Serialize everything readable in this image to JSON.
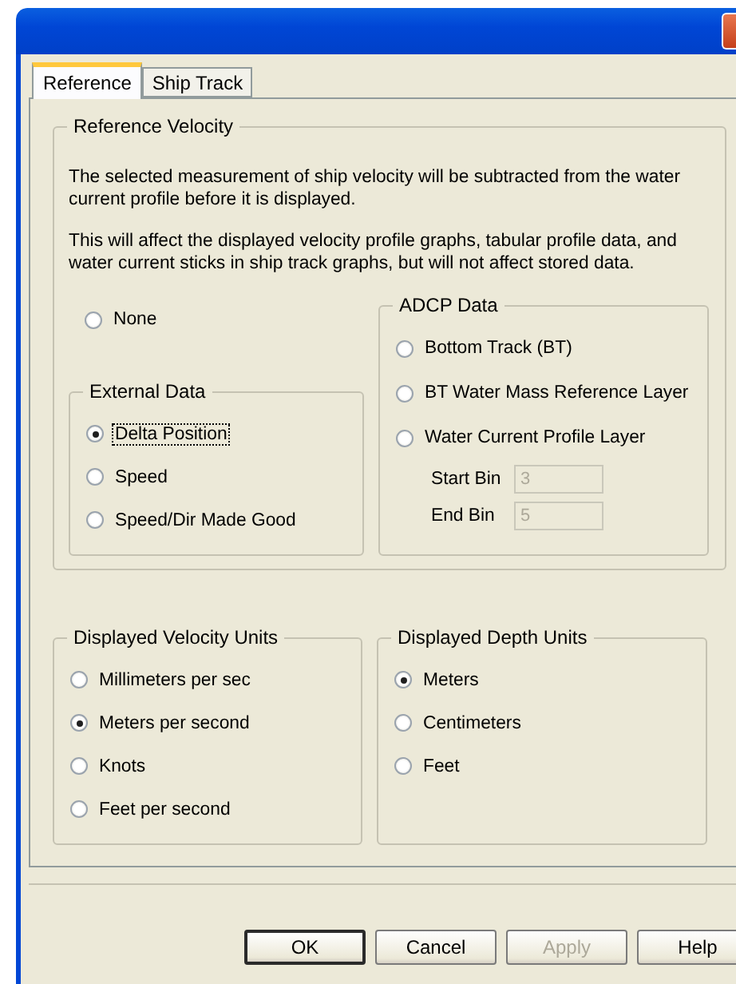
{
  "tabs": [
    {
      "label": "Reference",
      "selected": true
    },
    {
      "label": "Ship Track",
      "selected": false
    }
  ],
  "reference_velocity": {
    "title": "Reference Velocity",
    "paragraphs": [
      "The selected measurement of ship velocity will be subtracted from the water current profile before it is displayed.",
      "This will affect the displayed velocity profile graphs, tabular profile data, and water current sticks in ship track graphs, but will not affect stored data."
    ],
    "none_option": {
      "label": "None",
      "selected": false
    },
    "external_data": {
      "title": "External Data",
      "options": [
        {
          "label": "Delta Position",
          "selected": true,
          "focused": true
        },
        {
          "label": "Speed",
          "selected": false,
          "focused": false
        },
        {
          "label": "Speed/Dir Made Good",
          "selected": false,
          "focused": false
        }
      ]
    },
    "adcp_data": {
      "title": "ADCP Data",
      "options": [
        {
          "label": "Bottom Track (BT)",
          "selected": false
        },
        {
          "label": "BT Water Mass Reference Layer",
          "selected": false
        },
        {
          "label": "Water Current Profile Layer",
          "selected": false
        }
      ],
      "bins": [
        {
          "label": "Start Bin",
          "value": "3",
          "disabled": true
        },
        {
          "label": "End Bin",
          "value": "5",
          "disabled": true
        }
      ]
    }
  },
  "velocity_units": {
    "title": "Displayed Velocity Units",
    "options": [
      {
        "label": "Millimeters per sec",
        "selected": false
      },
      {
        "label": "Meters per second",
        "selected": true
      },
      {
        "label": "Knots",
        "selected": false
      },
      {
        "label": "Feet per second",
        "selected": false
      }
    ]
  },
  "depth_units": {
    "title": "Displayed Depth Units",
    "options": [
      {
        "label": "Meters",
        "selected": true
      },
      {
        "label": "Centimeters",
        "selected": false
      },
      {
        "label": "Feet",
        "selected": false
      }
    ]
  },
  "buttons": [
    {
      "label": "OK",
      "disabled": false,
      "default": true
    },
    {
      "label": "Cancel",
      "disabled": false,
      "default": false
    },
    {
      "label": "Apply",
      "disabled": true,
      "default": false
    },
    {
      "label": "Help",
      "disabled": false,
      "default": false
    }
  ]
}
